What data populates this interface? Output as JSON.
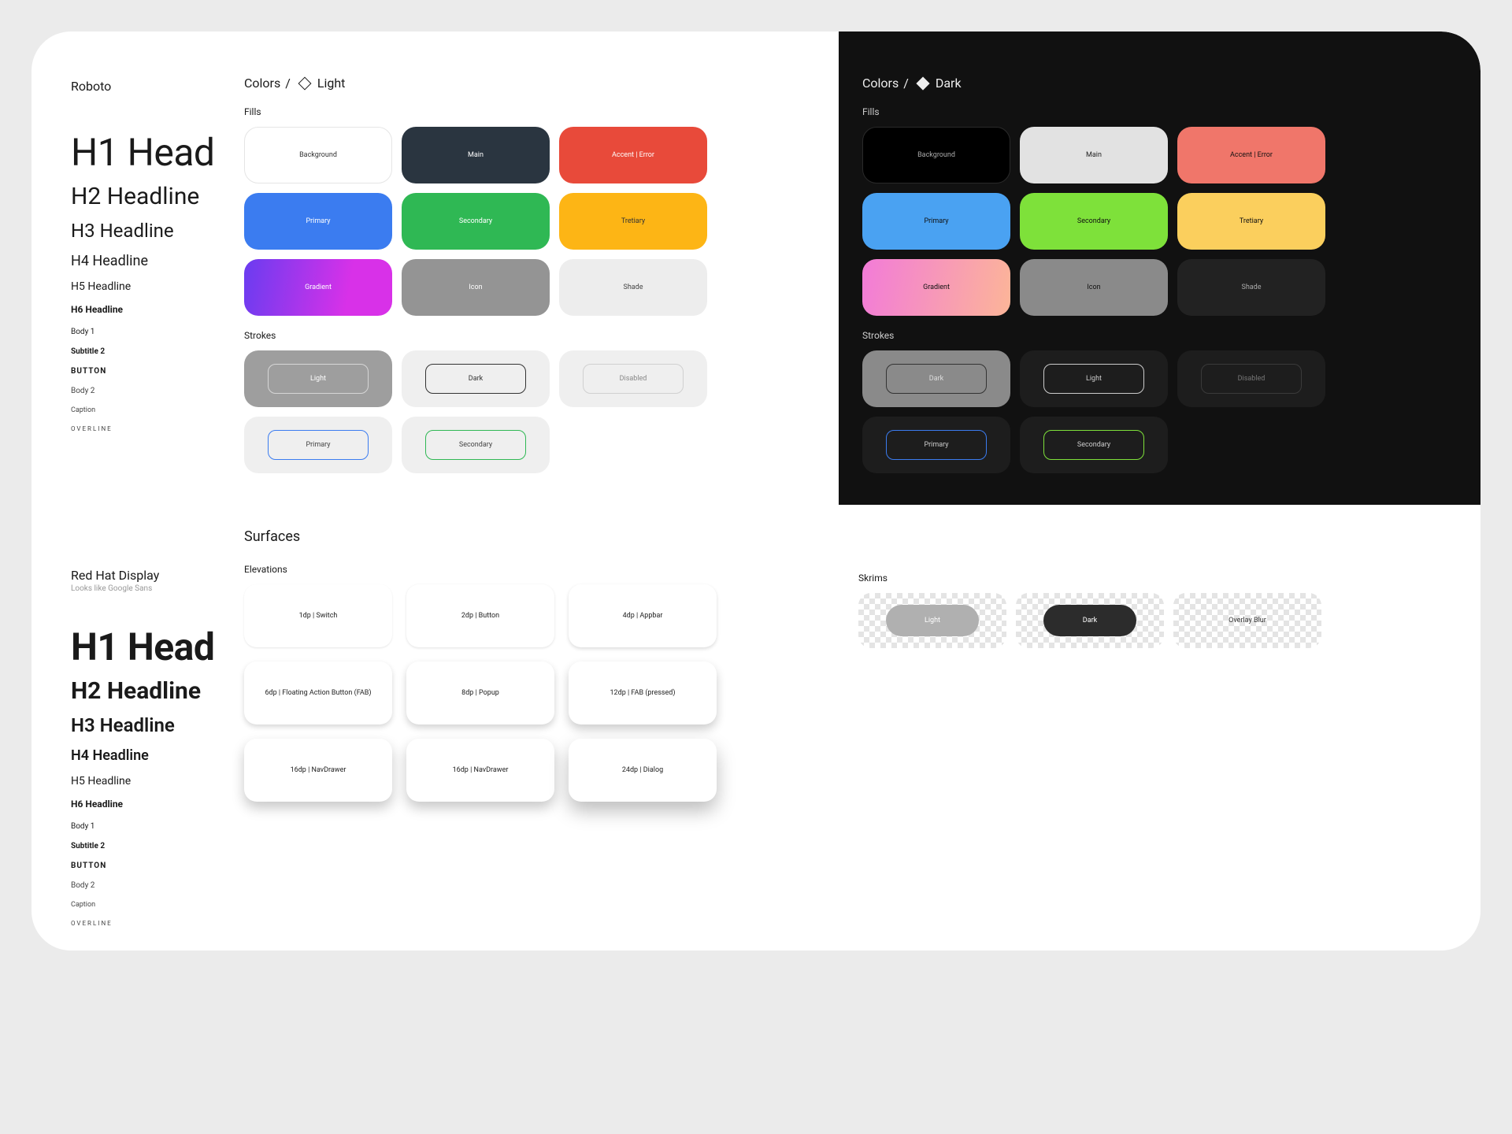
{
  "fonts": {
    "roboto": {
      "name": "Roboto"
    },
    "redhat": {
      "name": "Red Hat Display",
      "sub": "Looks like Google Sans"
    }
  },
  "typo": {
    "h1": "H1 Head",
    "h2": "H2 Headline",
    "h3": "H3 Headline",
    "h4": "H4 Headline",
    "h5": "H5 Headline",
    "h6": "H6 Headline",
    "body1": "Body 1",
    "subtitle2": "Subtitle 2",
    "button": "BUTTON",
    "body2": "Body 2",
    "caption": "Caption",
    "overline": "OVERLINE"
  },
  "sections": {
    "colors_prefix": "Colors",
    "sep": "/",
    "light": "Light",
    "dark": "Dark",
    "fills": "Fills",
    "strokes": "Strokes",
    "surfaces": "Surfaces",
    "elevations": "Elevations",
    "skrims": "Skrims"
  },
  "fills": {
    "background": "Background",
    "main": "Main",
    "accent": "Accent | Error",
    "primary": "Primary",
    "secondary": "Secondary",
    "tretiary": "Tretiary",
    "gradient": "Gradient",
    "icon": "Icon",
    "shade": "Shade"
  },
  "strokes": {
    "light": "Light",
    "dark": "Dark",
    "disabled": "Disabled",
    "primary": "Primary",
    "secondary": "Secondary"
  },
  "elevations": {
    "e1": "1dp | Switch",
    "e2": "2dp | Button",
    "e4": "4dp | Appbar",
    "e6": "6dp | Floating Action Button (FAB)",
    "e8": "8dp | Popup",
    "e12": "12dp | FAB (pressed)",
    "e16a": "16dp | NavDrawer",
    "e16b": "16dp | NavDrawer",
    "e24": "24dp | Dialog"
  },
  "skrims": {
    "light": "Light",
    "dark": "Dark",
    "overlay": "Overlay Blur"
  },
  "colors": {
    "light": {
      "background": "#ffffff",
      "main": "#2a3540",
      "accent": "#e84a3a",
      "primary": "#3b7cf0",
      "secondary": "#2fb854",
      "tretiary": "#fdb515",
      "icon": "#949494",
      "shade": "#ededed"
    },
    "dark": {
      "background": "#000000",
      "main": "#e2e2e2",
      "accent": "#f0766a",
      "primary": "#4aa2f2",
      "secondary": "#7ee13a",
      "tretiary": "#fbcf5d",
      "icon": "#8a8a8a",
      "shade": "#222222"
    }
  }
}
